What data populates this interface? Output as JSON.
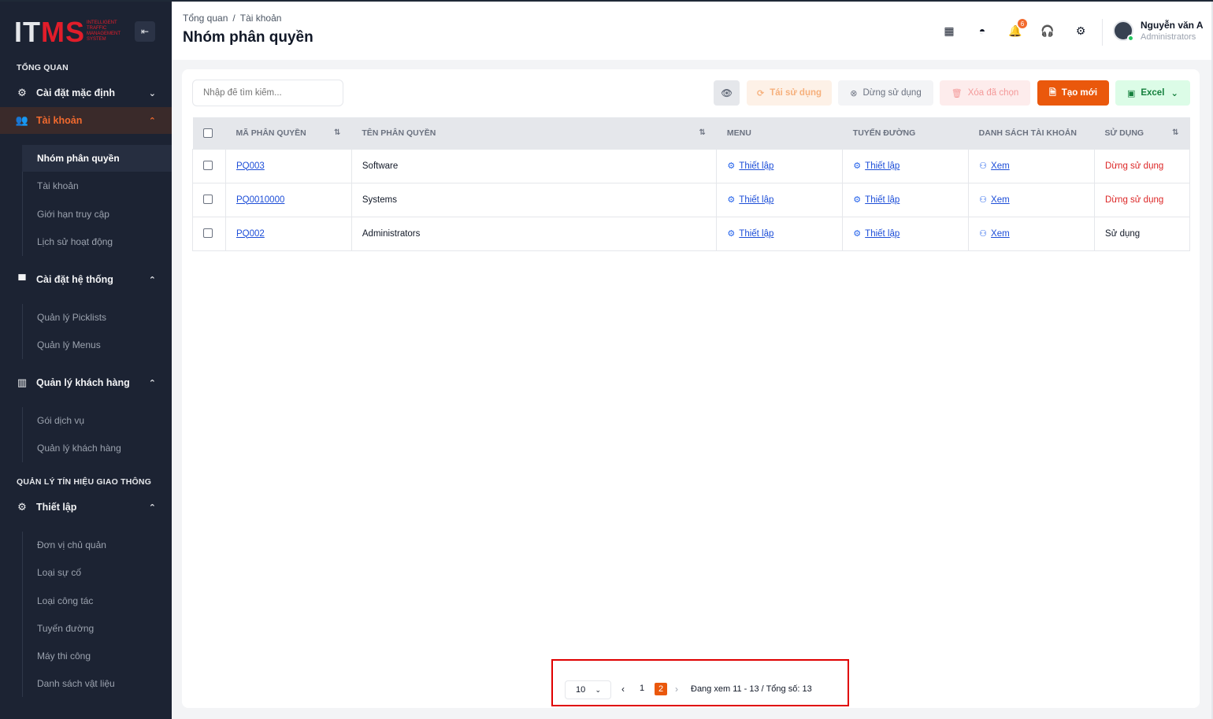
{
  "app": {
    "logo_text_a": "IT",
    "logo_text_b": "MS",
    "logo_subtitle": "INTELLIGENT TRAFFIC MANAGEMENT SYSTEM"
  },
  "sidebar": {
    "section_overview": "TỔNG QUAN",
    "menu_default_settings": "Cài đặt mặc định",
    "menu_accounts": "Tài khoản",
    "accounts_sub": [
      "Nhóm phân quyền",
      "Tài khoản",
      "Giới hạn truy cập",
      "Lịch sử hoạt động"
    ],
    "menu_system_settings": "Cài đặt hệ thống",
    "system_sub": [
      "Quản lý Picklists",
      "Quản lý Menus"
    ],
    "menu_customers": "Quản lý khách hàng",
    "customers_sub": [
      "Gói dịch vụ",
      "Quản lý khách hàng"
    ],
    "section_traffic": "QUẢN LÝ TÍN HIỆU GIAO THÔNG",
    "menu_setup": "Thiết lập",
    "setup_sub": [
      "Đơn vị chủ quản",
      "Loại sự cố",
      "Loại công tác",
      "Tuyến đường",
      "Máy thi công",
      "Danh sách vật liệu"
    ]
  },
  "header": {
    "breadcrumb": [
      "Tổng quan",
      "Tài khoản"
    ],
    "breadcrumb_sep": "/",
    "title": "Nhóm phân quyền",
    "notification_count": "6",
    "user_name": "Nguyễn văn A",
    "user_role": "Administrators"
  },
  "toolbar": {
    "search_placeholder": "Nhập để tìm kiếm...",
    "reuse_label": "Tái sử dụng",
    "stop_label": "Dừng sử dụng",
    "delete_label": "Xóa đã chọn",
    "create_label": "Tạo mới",
    "excel_label": "Excel"
  },
  "table": {
    "columns": [
      "MÃ PHÂN QUYỀN",
      "TÊN PHÂN QUYỀN",
      "MENU",
      "TUYẾN ĐƯỜNG",
      "DANH SÁCH TÀI KHOẢN",
      "SỬ DỤNG"
    ],
    "rows": [
      {
        "code": "PQ003",
        "name": "Software",
        "menu": "Thiết lập",
        "route": "Thiết lập",
        "accounts": "Xem",
        "status": "Dừng sử dụng"
      },
      {
        "code": "PQ0010000",
        "name": "Systems",
        "menu": "Thiết lập",
        "route": "Thiết lập",
        "accounts": "Xem",
        "status": "Dừng sử dụng"
      },
      {
        "code": "PQ002",
        "name": "Administrators",
        "menu": "Thiết lập",
        "route": "Thiết lập",
        "accounts": "Xem",
        "status": "Sử dụng"
      }
    ],
    "status_colors": {
      "stop": "#dc2626",
      "use": "#111827"
    }
  },
  "pagination": {
    "page_size": "10",
    "pages": [
      "1",
      "2"
    ],
    "current_page": "2",
    "info": "Đang xem 11 - 13 / Tổng số: 13"
  },
  "colors": {
    "accent": "#ea580c",
    "sidebar_bg": "#1c2333",
    "link": "#1d4ed8"
  },
  "icons": {
    "collapse": "collapse-left-icon",
    "settings": "gear-icon",
    "users": "users-icon",
    "system": "window-icon",
    "building": "building-icon"
  }
}
